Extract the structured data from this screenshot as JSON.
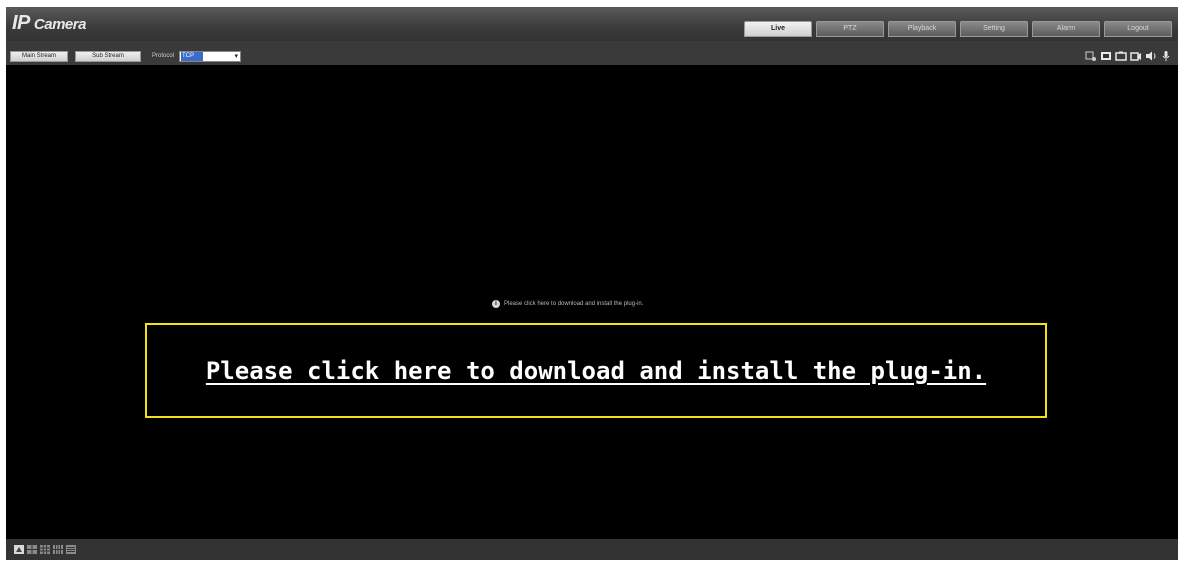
{
  "app": {
    "logo_main": "IP",
    "logo_sub": "Camera"
  },
  "nav": {
    "tabs": [
      {
        "label": "Live",
        "active": true
      },
      {
        "label": "PTZ",
        "active": false
      },
      {
        "label": "Playback",
        "active": false
      },
      {
        "label": "Setting",
        "active": false
      },
      {
        "label": "Alarm",
        "active": false
      },
      {
        "label": "Logout",
        "active": false
      }
    ]
  },
  "toolbar": {
    "main_stream_label": "Main Stream",
    "sub_stream_label": "Sub Stream",
    "protocol_label": "Protocol",
    "protocol_value": "TCP",
    "tools": [
      "zoom-icon",
      "fullscreen-icon",
      "snapshot-icon",
      "record-icon",
      "audio-icon",
      "microphone-icon"
    ]
  },
  "video": {
    "plugin_prompt_small": "Please click here to download and install the plug-in.",
    "plugin_prompt_large": "Please click here to download and install the plug-in.",
    "highlight_color": "#f2e018"
  },
  "bottom": {
    "layouts": [
      "layout-1-icon",
      "layout-4-icon",
      "layout-9-icon",
      "layout-16-icon",
      "layout-list-icon"
    ]
  }
}
